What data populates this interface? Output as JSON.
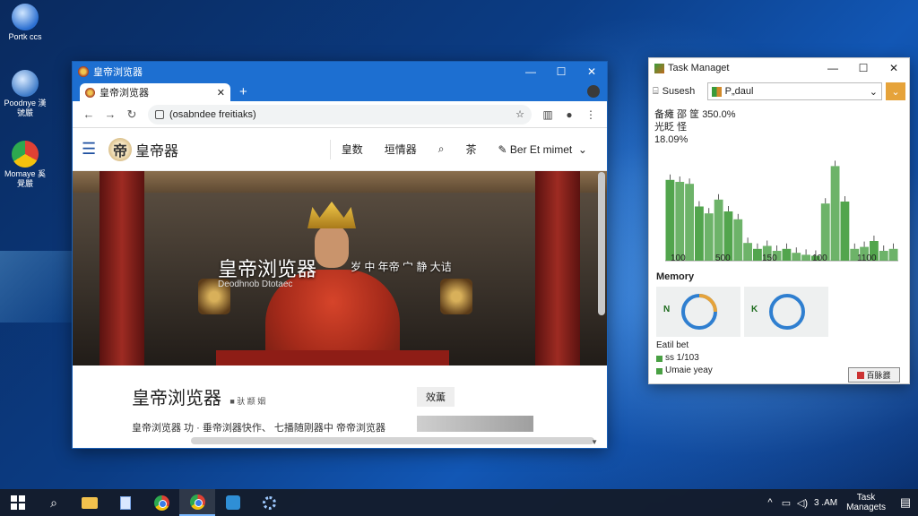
{
  "desktop": {
    "icons": [
      {
        "label": "Portk ccs",
        "icon": "globe-icon"
      },
      {
        "label": "Poodnye 漢號嚴",
        "icon": "globe-icon"
      },
      {
        "label": "Momaye 奚覺嚴",
        "icon": "chrome-icon"
      }
    ]
  },
  "browser": {
    "window_title": "皇帝浏览器",
    "tab_label": "皇帝浏览器",
    "url": "(osabndee freitiaks)",
    "site": {
      "logo_mark": "帝",
      "logo_text": "皇帝器",
      "nav": [
        "皇数",
        "垣情器",
        "茶",
        "Ber Et mimet"
      ],
      "hero_title": "皇帝浏览器",
      "hero_subtitle": "Deodhnob Dtotaec",
      "hero_tagline": "岁 中 年帝 宀 静 大诘",
      "content_title": "皇帝浏览器",
      "content_title_tag": "■ 驮 颛 姻",
      "content_body": "皇帝浏览器 功 · 垂帝浏器快作、 七播随刚器中 帝帝浏览器",
      "side_heading": "效薫"
    }
  },
  "task_manager": {
    "title": "Task Managet",
    "search_label": "Susesh",
    "dropdown_value": "P„daul",
    "stat_label_1": "备瘫 邵 筐",
    "stat_value_1": "350.0%",
    "stat_label_2": "光眨 怪",
    "stat_value_2": "18.09%",
    "memory_heading": "Memory",
    "card_letters": [
      "N",
      "K"
    ],
    "legend_title": "Eatil bet",
    "legend_items": [
      "ss 1/103",
      "Umaie yeay"
    ],
    "end_button": "百脉鼝",
    "chart_accent": "#49a043"
  },
  "chart_data": {
    "type": "bar",
    "categories": [
      "100",
      "500",
      "150",
      "100",
      "1100"
    ],
    "values": [
      82,
      80,
      78,
      55,
      48,
      62,
      50,
      42,
      18,
      12,
      15,
      10,
      12,
      8,
      6,
      5,
      58,
      96,
      60,
      12,
      14,
      20,
      10,
      12
    ],
    "series": [
      {
        "values": [
          82,
          80,
          78,
          55,
          48,
          62,
          50,
          42,
          18,
          12,
          15,
          10,
          12,
          8,
          6,
          5,
          58,
          96,
          60,
          12,
          14,
          20,
          10,
          12
        ]
      }
    ],
    "xlabel": "",
    "ylabel": "",
    "grid": false,
    "color": "#49a043"
  },
  "taskbar": {
    "items": [
      "start-button",
      "search-button",
      "file-explorer",
      "notes",
      "chrome",
      "chrome-active",
      "defender",
      "settings"
    ],
    "tray_time": "3 .AM",
    "tray_clock_line1": "Task",
    "tray_clock_line2": "Managets"
  }
}
